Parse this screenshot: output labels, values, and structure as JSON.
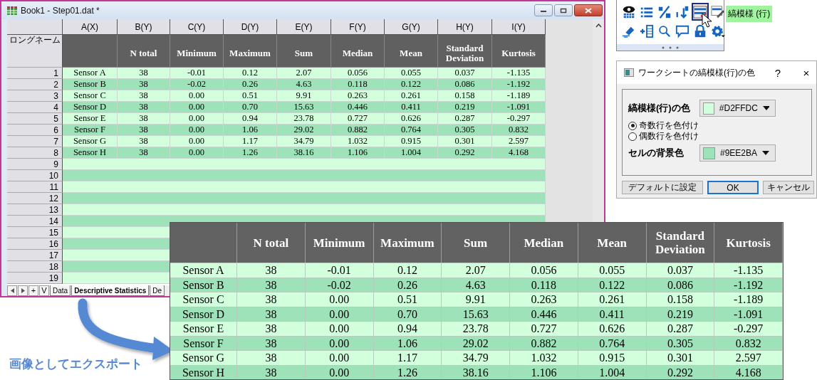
{
  "worksheet": {
    "title": "Book1 - Step01.dat *",
    "columns": [
      "A(X)",
      "B(Y)",
      "C(Y)",
      "D(Y)",
      "E(Y)",
      "F(Y)",
      "G(Y)",
      "H(Y)",
      "I(Y)"
    ],
    "long_name_label": "ロングネーム",
    "long_names": [
      "N total",
      "Minimum",
      "Maximum",
      "Sum",
      "Median",
      "Mean",
      "Standard Deviation",
      "Kurtosis"
    ],
    "rows": [
      {
        "number": "1",
        "cells": [
          "Sensor A",
          "38",
          "-0.01",
          "0.12",
          "2.07",
          "0.056",
          "0.055",
          "0.037",
          "-1.135"
        ]
      },
      {
        "number": "2",
        "cells": [
          "Sensor B",
          "38",
          "-0.02",
          "0.26",
          "4.63",
          "0.118",
          "0.122",
          "0.086",
          "-1.192"
        ]
      },
      {
        "number": "3",
        "cells": [
          "Sensor C",
          "38",
          "0.00",
          "0.51",
          "9.91",
          "0.263",
          "0.261",
          "0.158",
          "-1.189"
        ]
      },
      {
        "number": "4",
        "cells": [
          "Sensor D",
          "38",
          "0.00",
          "0.70",
          "15.63",
          "0.446",
          "0.411",
          "0.219",
          "-1.091"
        ]
      },
      {
        "number": "5",
        "cells": [
          "Sensor E",
          "38",
          "0.00",
          "0.94",
          "23.78",
          "0.727",
          "0.626",
          "0.287",
          "-0.297"
        ]
      },
      {
        "number": "6",
        "cells": [
          "Sensor F",
          "38",
          "0.00",
          "1.06",
          "29.02",
          "0.882",
          "0.764",
          "0.305",
          "0.832"
        ]
      },
      {
        "number": "7",
        "cells": [
          "Sensor G",
          "38",
          "0.00",
          "1.17",
          "34.79",
          "1.032",
          "0.915",
          "0.301",
          "2.597"
        ]
      },
      {
        "number": "8",
        "cells": [
          "Sensor H",
          "38",
          "0.00",
          "1.26",
          "38.16",
          "1.106",
          "1.004",
          "0.292",
          "4.168"
        ]
      },
      {
        "number": "9"
      },
      {
        "number": "10"
      },
      {
        "number": "11"
      },
      {
        "number": "12"
      },
      {
        "number": "13"
      },
      {
        "number": "14"
      },
      {
        "number": "15"
      },
      {
        "number": "16"
      },
      {
        "number": "17"
      },
      {
        "number": "18"
      },
      {
        "number": "19"
      }
    ],
    "sheet_nav": [
      "+",
      "V"
    ],
    "sheet_tabs": [
      {
        "label": "Data",
        "selected": false
      },
      {
        "label": "Descriptive Statistics",
        "selected": true
      },
      {
        "label": "De",
        "selected": false
      }
    ]
  },
  "toolbar": {
    "buttons": [
      {
        "kind": "view",
        "selected": false
      },
      {
        "kind": "list",
        "selected": false
      },
      {
        "kind": "formula",
        "selected": false
      },
      {
        "kind": "sort",
        "selected": false
      },
      {
        "kind": "stripes",
        "selected": true
      },
      {
        "kind": "table-edit",
        "selected": false
      },
      {
        "kind": "eraser",
        "selected": false
      },
      {
        "kind": "add-column",
        "selected": false
      },
      {
        "kind": "search",
        "selected": false
      },
      {
        "kind": "comment",
        "selected": false
      },
      {
        "kind": "lock",
        "selected": false
      },
      {
        "kind": "gear",
        "selected": false
      }
    ],
    "tooltip": "縞模様 (行)"
  },
  "dialog": {
    "title": "ワークシートの縞模様(行)の色",
    "help": "?",
    "close": "×",
    "stripe_label": "縞模様(行)の色",
    "stripe_color": {
      "text": "#D2FFDC",
      "color": "#d2ffdc"
    },
    "options": [
      {
        "label": "奇数行を色付け",
        "selected": true
      },
      {
        "label": "偶数行を色付け",
        "selected": false
      }
    ],
    "background_label": "セルの背景色",
    "background_color": {
      "text": "#9EE2BA",
      "color": "#9ee2ba"
    },
    "buttons": [
      {
        "label": "デフォルトに設定",
        "default": false
      },
      {
        "label": "OK",
        "default": true
      },
      {
        "label": "キャンセル",
        "default": false
      }
    ]
  },
  "export": {
    "caption": "画像としてエクスポート",
    "columns": [
      "",
      "N total",
      "Minimum",
      "Maximum",
      "Sum",
      "Median",
      "Mean",
      "Standard Deviation",
      "Kurtosis"
    ],
    "rows": [
      [
        "Sensor A",
        "38",
        "-0.01",
        "0.12",
        "2.07",
        "0.056",
        "0.055",
        "0.037",
        "-1.135"
      ],
      [
        "Sensor B",
        "38",
        "-0.02",
        "0.26",
        "4.63",
        "0.118",
        "0.122",
        "0.086",
        "-1.192"
      ],
      [
        "Sensor C",
        "38",
        "0.00",
        "0.51",
        "9.91",
        "0.263",
        "0.261",
        "0.158",
        "-1.189"
      ],
      [
        "Sensor D",
        "38",
        "0.00",
        "0.70",
        "15.63",
        "0.446",
        "0.411",
        "0.219",
        "-1.091"
      ],
      [
        "Sensor E",
        "38",
        "0.00",
        "0.94",
        "23.78",
        "0.727",
        "0.626",
        "0.287",
        "-0.297"
      ],
      [
        "Sensor F",
        "38",
        "0.00",
        "1.06",
        "29.02",
        "0.882",
        "0.764",
        "0.305",
        "0.832"
      ],
      [
        "Sensor G",
        "38",
        "0.00",
        "1.17",
        "34.79",
        "1.032",
        "0.915",
        "0.301",
        "2.597"
      ],
      [
        "Sensor H",
        "38",
        "0.00",
        "1.26",
        "38.16",
        "1.106",
        "1.004",
        "0.292",
        "4.168"
      ]
    ]
  }
}
